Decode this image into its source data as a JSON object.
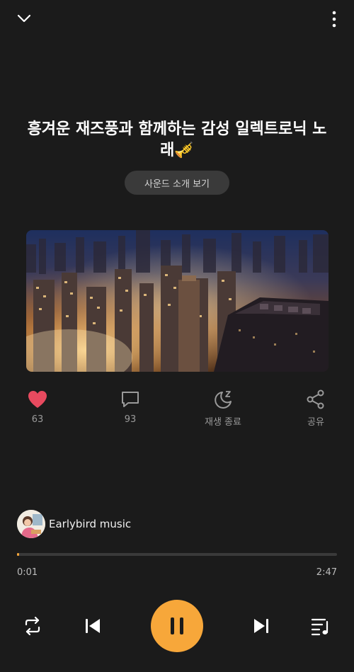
{
  "player": {
    "title": "흥겨운 재즈풍과 함께하는 감성 일렉트로닉 노래🎺",
    "intro_button": "사운드 소개 보기"
  },
  "actions": {
    "like_count": "63",
    "comment_count": "93",
    "sleep_label": "재생 종료",
    "share_label": "공유"
  },
  "artist": {
    "name": "Earlybird music"
  },
  "playback": {
    "current_time": "0:01",
    "duration": "2:47",
    "progress_fraction": 0.006
  },
  "icons": {
    "collapse": "chevron-down-icon",
    "more": "more-vertical-icon",
    "like": "heart-icon",
    "comment": "comment-icon",
    "sleep": "moon-sleep-icon",
    "share": "share-icon",
    "repeat": "repeat-icon",
    "previous": "skip-previous-icon",
    "pause": "pause-icon",
    "next": "skip-next-icon",
    "playlist": "playlist-icon"
  },
  "colors": {
    "accent": "#f7a73a",
    "like": "#e84a5f",
    "background": "#1b1b1b"
  }
}
